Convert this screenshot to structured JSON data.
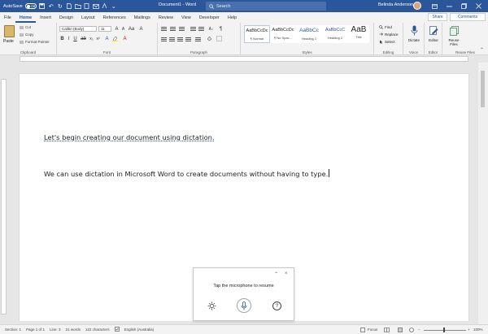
{
  "titlebar": {
    "autosave_label": "AutoSave",
    "autosave_state": "Off",
    "doc_title": "Document1 - Word",
    "search_placeholder": "Search",
    "user_name": "Belinda Anderson"
  },
  "tabs": [
    "File",
    "Home",
    "Insert",
    "Design",
    "Layout",
    "References",
    "Mailings",
    "Review",
    "View",
    "Developer",
    "Help"
  ],
  "active_tab": "Home",
  "share_label": "Share",
  "comments_label": "Comments",
  "ribbon": {
    "clipboard": {
      "paste": "Paste",
      "cut": "Cut",
      "copy": "Copy",
      "format_painter": "Format Painter",
      "label": "Clipboard"
    },
    "font": {
      "font_name": "Calibri (Body)",
      "font_size": "11",
      "label": "Font"
    },
    "paragraph": {
      "label": "Paragraph"
    },
    "styles": {
      "items": [
        {
          "sample": "AaBbCcDc",
          "name": "¶ Normal"
        },
        {
          "sample": "AaBbCcDc",
          "name": "¶ No Spac..."
        },
        {
          "sample": "AaBbCc",
          "name": "Heading 1"
        },
        {
          "sample": "AaBbCcC",
          "name": "Heading 2"
        },
        {
          "sample": "AaB",
          "name": "Title"
        }
      ],
      "label": "Styles"
    },
    "editing": {
      "find": "Find",
      "replace": "Replace",
      "select": "Select",
      "label": "Editing"
    },
    "voice": {
      "dictate": "Dictate",
      "label": "Voice"
    },
    "editor": {
      "editor": "Editor",
      "label": "Editor"
    },
    "reuse": {
      "reuse_files": "Reuse Files",
      "label": "Reuse Files"
    }
  },
  "document": {
    "line1": "Let's begin creating our document using dictation.",
    "line2": "We can use dictation in Microsoft Word to create documents without having to type."
  },
  "dictation_panel": {
    "prompt": "Tap the microphone to resume"
  },
  "statusbar": {
    "section": "Section: 1",
    "page": "Page 1 of 1",
    "line": "Line: 3",
    "words": "21 words",
    "characters": "122 characters",
    "language": "English (Australia)",
    "focus": "Focus",
    "zoom": "100%"
  }
}
